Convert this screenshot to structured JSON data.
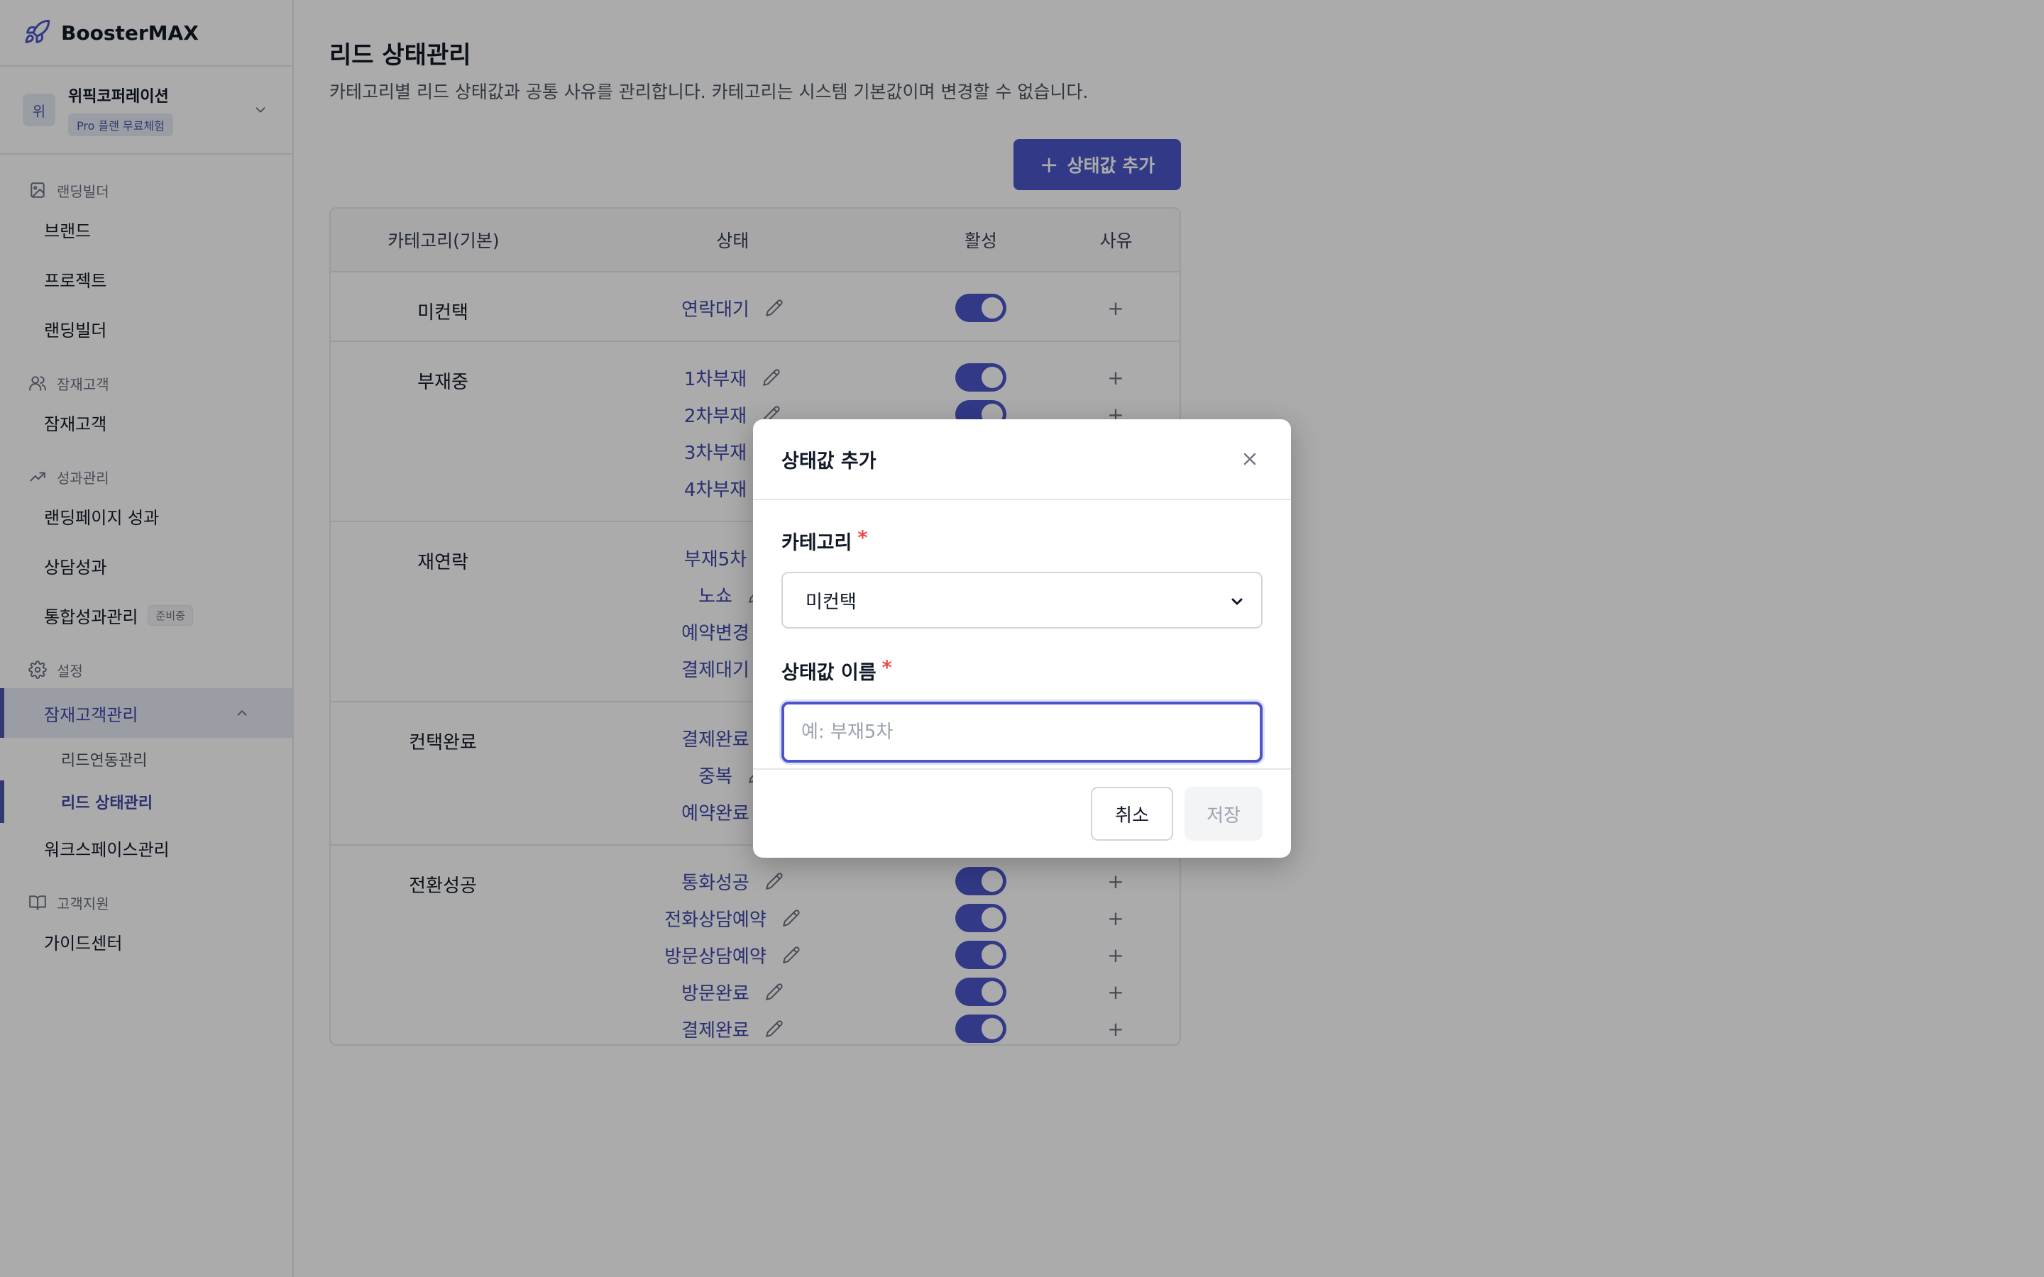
{
  "app": {
    "name": "BoosterMAX"
  },
  "workspace": {
    "avatar": "위",
    "name": "위픽코퍼레이션",
    "plan_badge": "Pro 플랜 무료체험"
  },
  "sidebar": {
    "sections": [
      {
        "header": "랜딩빌더",
        "icon": "image-icon",
        "items": [
          "브랜드",
          "프로젝트",
          "랜딩빌더"
        ]
      },
      {
        "header": "잠재고객",
        "icon": "users-icon",
        "items": [
          "잠재고객"
        ]
      },
      {
        "header": "성과관리",
        "icon": "trend-icon",
        "items": [
          "랜딩페이지 성과",
          "상담성과",
          "통합성과관리"
        ],
        "tag": "준비중"
      },
      {
        "header": "설정",
        "icon": "gear-icon",
        "expanded_item": "잠재고객관리",
        "sub_items": [
          "리드연동관리",
          "리드 상태관리"
        ],
        "after_item": "워크스페이스관리"
      },
      {
        "header": "고객지원",
        "icon": "book-icon",
        "items": [
          "가이드센터"
        ]
      }
    ]
  },
  "page": {
    "title": "리드 상태관리",
    "description": "카테고리별 리드 상태값과 공통 사유를 관리합니다. 카테고리는 시스템 기본값이며 변경할 수 없습니다.",
    "add_button": "상태값 추가"
  },
  "table": {
    "headers": {
      "category": "카테고리(기본)",
      "status": "상태",
      "active": "활성",
      "reason": "사유"
    },
    "groups": [
      {
        "category": "미컨택",
        "statuses": [
          "연락대기"
        ]
      },
      {
        "category": "부재중",
        "statuses": [
          "1차부재",
          "2차부재",
          "3차부재",
          "4차부재"
        ]
      },
      {
        "category": "재연락",
        "statuses": [
          "부재5차",
          "노쇼",
          "예약변경",
          "결제대기"
        ]
      },
      {
        "category": "컨택완료",
        "statuses": [
          "결제완료",
          "중복",
          "예약완료"
        ]
      },
      {
        "category": "전환성공",
        "statuses": [
          "통화성공",
          "전화상담예약",
          "방문상담예약",
          "방문완료",
          "결제완료"
        ]
      }
    ],
    "reason_symbol": "+"
  },
  "modal": {
    "title": "상태값 추가",
    "category_label": "카테고리",
    "category_value": "미컨택",
    "name_label": "상태값 이름",
    "name_placeholder": "예: 부재5차",
    "required_mark": "*",
    "cancel": "취소",
    "save": "저장"
  },
  "colors": {
    "accent": "#4b55c8",
    "accent_text": "#3f48a8",
    "required": "#ef4444"
  }
}
